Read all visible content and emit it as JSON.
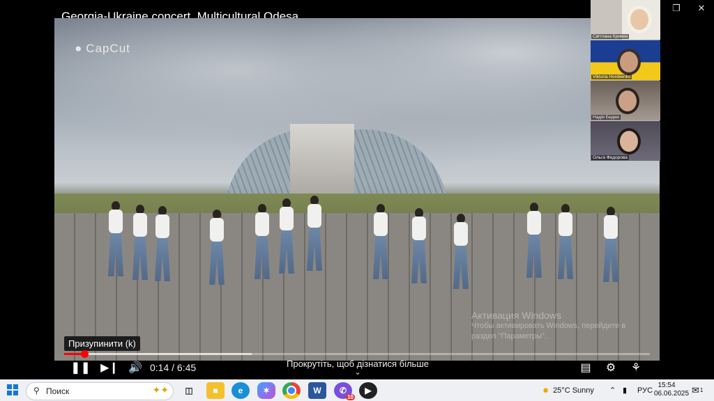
{
  "video": {
    "title": "Georgia-Ukraine concert. Multicultural Odesa",
    "watermark_logo": "CapCut",
    "tooltip": "Призупинити (k)",
    "time": "0:14 / 6:45",
    "progress": 0.035,
    "buffered": 0.32,
    "scroll_hint": "Прокрутіть, щоб дізнатися більше"
  },
  "window_controls": [
    "minimize",
    "restore",
    "close"
  ],
  "activation": {
    "title": "Активация Windows",
    "line1": "Чтобы активировать Windows, перейдите в",
    "line2": "раздел \"Параметры\"."
  },
  "participants": [
    {
      "name": "Світлана Кривен"
    },
    {
      "name": "Viktoria Hordiienko"
    },
    {
      "name": "Надія Бедюк"
    },
    {
      "name": "Ольга Федорова"
    }
  ],
  "taskbar": {
    "search_label": "Поиск",
    "weather": "25°C  Sunny",
    "lang": "РУС",
    "time": "15:54",
    "date": "06.06.2025",
    "badge_count": "10",
    "notif_count": "1"
  },
  "colors": {
    "progress": "#ff0000",
    "taskbar": "#eef0f4",
    "accent": "#1277d6"
  }
}
